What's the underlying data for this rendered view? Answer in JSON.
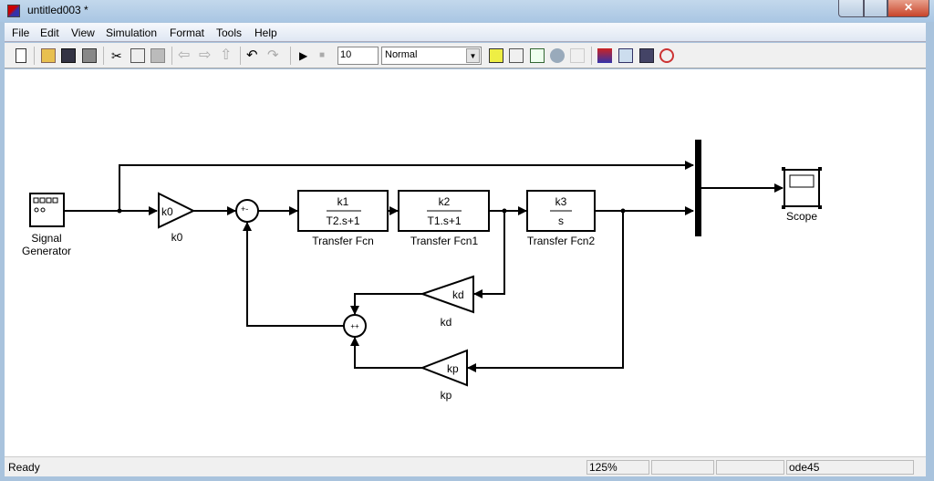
{
  "window": {
    "title": "untitled003 *"
  },
  "menu": [
    "File",
    "Edit",
    "View",
    "Simulation",
    "Format",
    "Tools",
    "Help"
  ],
  "toolbar": {
    "stop_time": "10",
    "mode": "Normal",
    "icons": [
      "new-icon",
      "open-icon",
      "save-icon",
      "print-icon",
      "cut-icon",
      "copy-icon",
      "paste-icon",
      "back-icon",
      "forward-icon",
      "up-icon",
      "undo-icon",
      "redo-icon",
      "play-icon",
      "stop-icon",
      "build-icon",
      "library-icon",
      "update-icon",
      "model-explorer-icon",
      "debug-icon",
      "library-browser-icon",
      "find-icon",
      "properties-icon",
      "help-icon"
    ]
  },
  "blocks": {
    "signal_generator": {
      "label1": "Signal",
      "label2": "Generator"
    },
    "k0": {
      "text": "k0",
      "label": "k0"
    },
    "tf": {
      "num": "k1",
      "den": "T2.s+1",
      "label": "Transfer Fcn"
    },
    "tf1": {
      "num": "k2",
      "den": "T1.s+1",
      "label": "Transfer Fcn1"
    },
    "tf2": {
      "num": "k3",
      "den": "s",
      "label": "Transfer Fcn2"
    },
    "kd": {
      "text": "kd",
      "label": "kd"
    },
    "kp": {
      "text": "kp",
      "label": "kp"
    },
    "scope": {
      "label": "Scope"
    },
    "sum1": {
      "signs": "+-"
    },
    "sum2": {
      "signs": "++"
    }
  },
  "status": {
    "text": "Ready",
    "zoom": "125%",
    "solver": "ode45"
  }
}
